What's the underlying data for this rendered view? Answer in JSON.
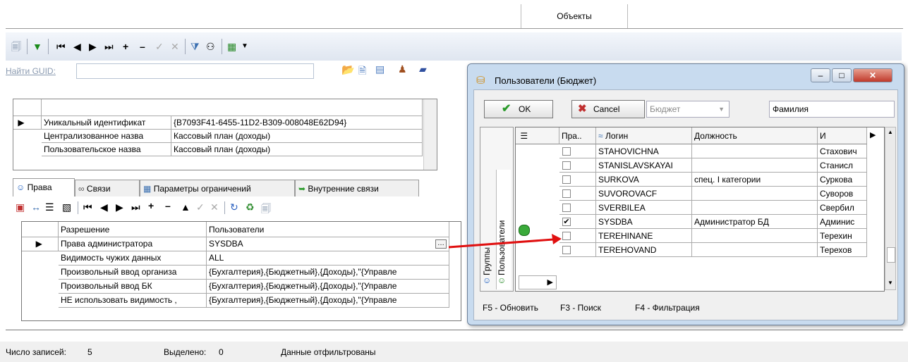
{
  "top_tab": {
    "label": "Объекты"
  },
  "find": {
    "label": "Найти GUID:",
    "value": ""
  },
  "properties": {
    "rows": [
      {
        "name": "Уникальный идентификат",
        "value": "{B7093F41-6455-11D2-B309-008048E62D94}"
      },
      {
        "name": "Централизованное назва",
        "value": "Кассовый план (доходы)"
      },
      {
        "name": "Пользовательское назва",
        "value": "Кассовый план (доходы)"
      }
    ]
  },
  "tabs": [
    {
      "label": "Права"
    },
    {
      "label": "Связи"
    },
    {
      "label": "Параметры ограничений"
    },
    {
      "label": "Внутренние связи"
    }
  ],
  "rights": {
    "headers": {
      "permission": "Разрешение",
      "users": "Пользователи"
    },
    "rows": [
      {
        "permission": "Права администратора",
        "users": "SYSDBA"
      },
      {
        "permission": "Видимость чужих данных",
        "users": "ALL"
      },
      {
        "permission": "Произвольный ввод организа",
        "users": "{Бухгалтерия},{Бюджетный},{Доходы},\"{Управле"
      },
      {
        "permission": "Произвольный ввод БК",
        "users": "{Бухгалтерия},{Бюджетный},{Доходы},\"{Управле"
      },
      {
        "permission": "НЕ использовать видимость ,",
        "users": "{Бухгалтерия},{Бюджетный},{Доходы},\"{Управле"
      }
    ]
  },
  "status": {
    "count_label": "Число записей:",
    "count": "5",
    "selected_label": "Выделено:",
    "selected": "0",
    "filtered": "Данные отфильтрованы"
  },
  "dialog": {
    "title": "Пользователи (Бюджет)",
    "ok": "OK",
    "cancel": "Cancel",
    "combo_value": "Бюджет",
    "field_value": "Фамилия",
    "vtab_users": "Пользователи",
    "vtab_groups": "Группы",
    "headers": {
      "rights": "Пра..",
      "login": "Логин",
      "position": "Должность",
      "name": "И"
    },
    "rows": [
      {
        "checked": false,
        "login": "STAHOVICHNA",
        "position": "",
        "name": "Стахович"
      },
      {
        "checked": false,
        "login": "STANISLAVSKAYAI",
        "position": "",
        "name": "Станисл"
      },
      {
        "checked": false,
        "login": "SURKOVA",
        "position": "спец. I категории",
        "name": "Суркова"
      },
      {
        "checked": false,
        "login": "SUVOROVACF",
        "position": "",
        "name": "Суворов"
      },
      {
        "checked": false,
        "login": "SVERBILEA",
        "position": "",
        "name": "Свербил"
      },
      {
        "checked": true,
        "login": "SYSDBA",
        "position": "Администратор БД",
        "name": "Админис"
      },
      {
        "checked": false,
        "login": "TEREHINANE",
        "position": "",
        "name": "Терехин"
      },
      {
        "checked": false,
        "login": "TEREHOVAND",
        "position": "",
        "name": "Терехов"
      }
    ],
    "f5": "F5 - Обновить",
    "f3": "F3 - Поиск",
    "f4": "F4 - Фильтрация"
  }
}
